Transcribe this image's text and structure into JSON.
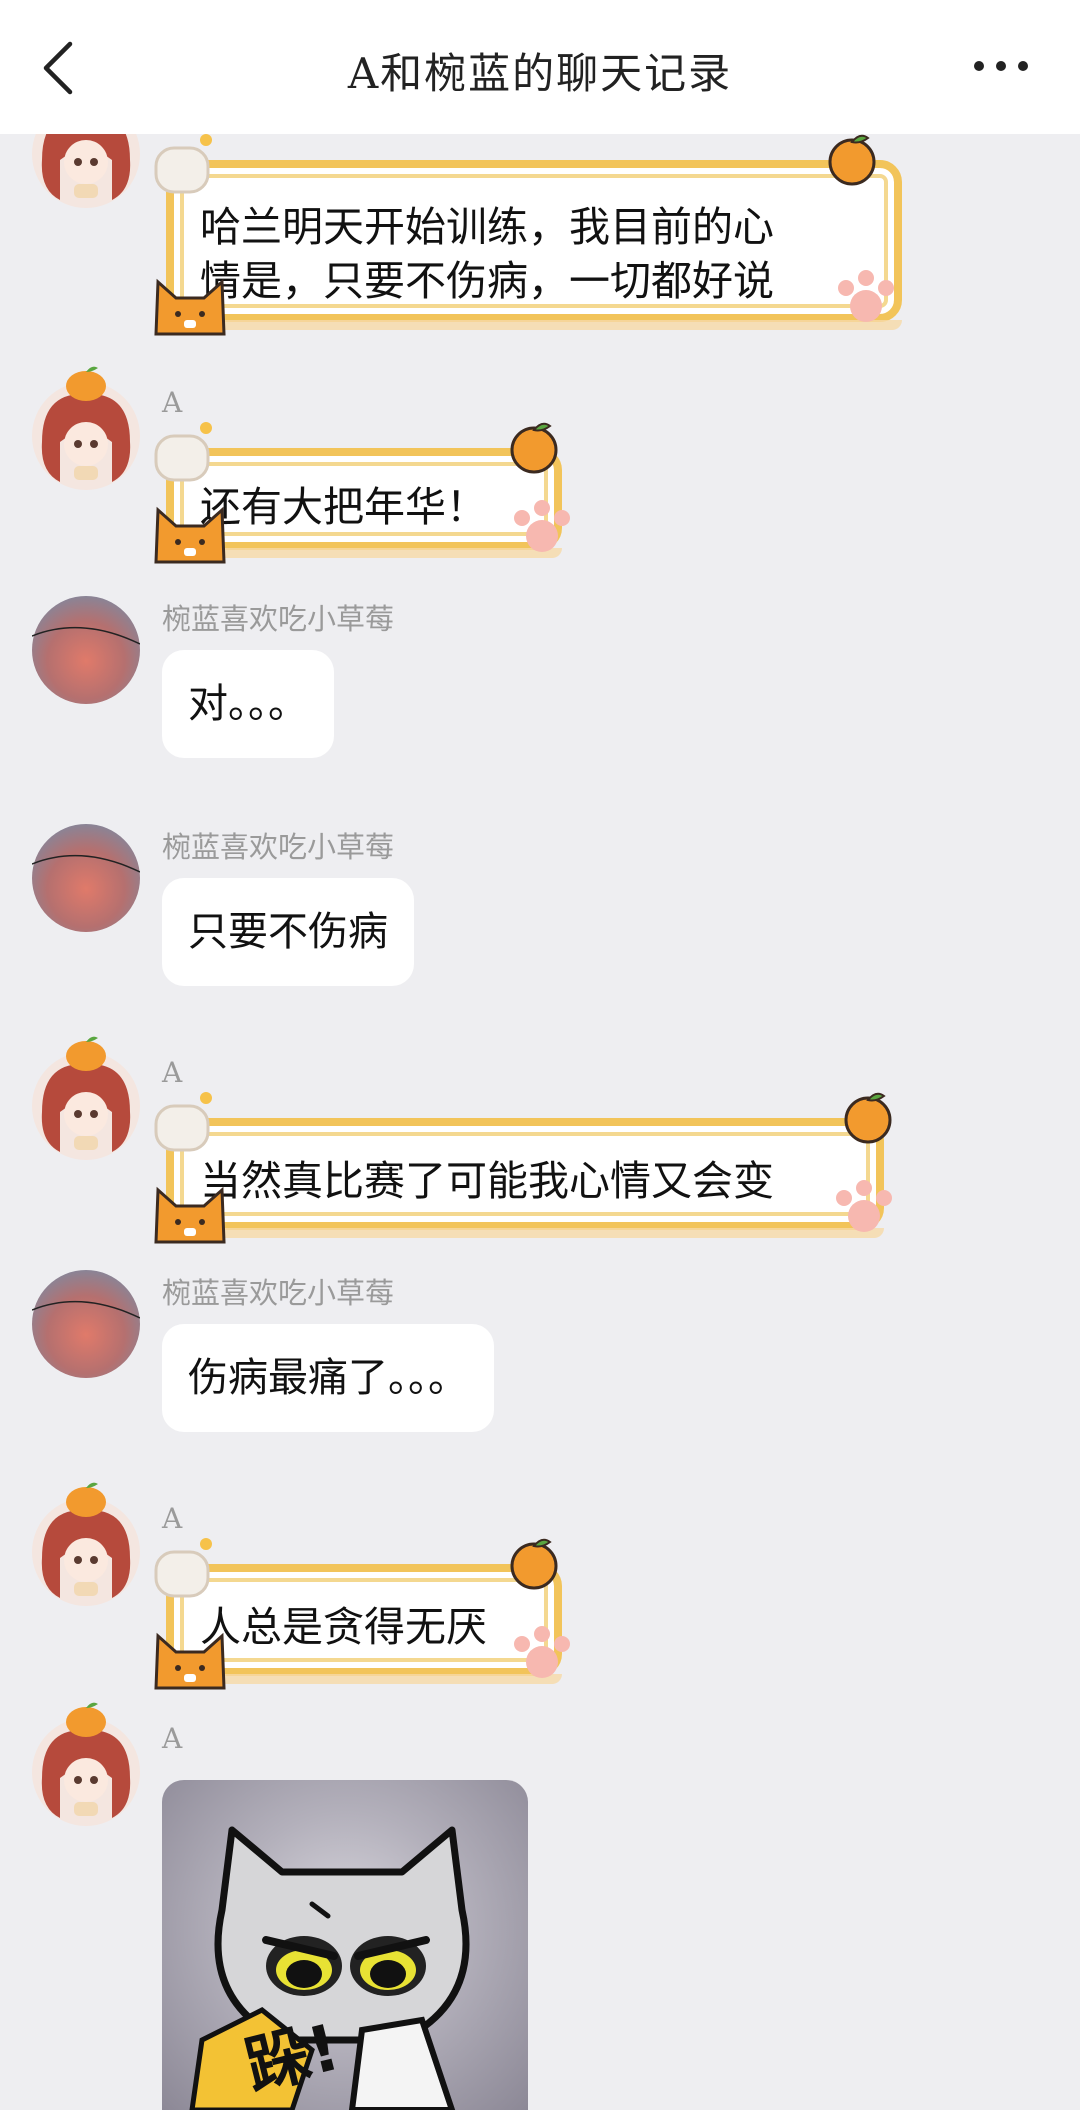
{
  "header": {
    "title": "A和椀蓝的聊天记录"
  },
  "messages": [
    {
      "sender": "A",
      "text_line1": "哈兰明天开始训练，我目前的心",
      "text_line2": "情是，只要不伤病，一切都好说"
    },
    {
      "sender": "A",
      "text": "还有大把年华！"
    },
    {
      "sender": "椀蓝喜欢吃小草莓",
      "text": "对。。。"
    },
    {
      "sender": "椀蓝喜欢吃小草莓",
      "text": "只要不伤病"
    },
    {
      "sender": "A",
      "text": "当然真比赛了可能我心情又会变"
    },
    {
      "sender": "椀蓝喜欢吃小草莓",
      "text": "伤病最痛了。。。"
    },
    {
      "sender": "A",
      "text": "人总是贪得无厌"
    },
    {
      "sender": "A",
      "sticker_text": "跺!"
    }
  ],
  "colors": {
    "background": "#eeeef1",
    "bubble": "#ffffff",
    "frame_gold": "#f2c45a",
    "orange": "#f29a2e"
  }
}
